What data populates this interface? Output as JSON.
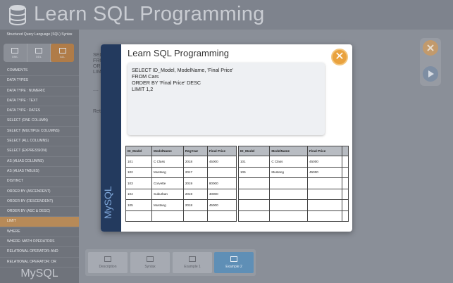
{
  "app": {
    "title": "Learn SQL Programming",
    "sidebar_subtitle": "Structured Query Language (SQL) Syntax",
    "brand": "MySQL"
  },
  "segments": [
    {
      "label": "DML",
      "active": false
    },
    {
      "label": "DDL",
      "active": false
    },
    {
      "label": "ALL",
      "active": true
    }
  ],
  "menu": [
    "COMMENTS",
    "DATA TYPES",
    "DATA TYPE : NUMERIC",
    "DATA TYPE : TEXT",
    "DATA TYPE : DATES",
    "SELECT (ONE COLUMN)",
    "SELECT (MULTIPLE COLUMNS)",
    "SELECT (ALL COLUMNS)",
    "SELECT (EXPRESSION)",
    "AS (ALIAS COLUMNS)",
    "AS (ALIAS TABLES)",
    "DISTINCT",
    "ORDER BY (ASCENDENT)",
    "ORDER BY (DESCENDENT)",
    "ORDER BY (ASC & DESC)",
    "LIMIT",
    "WHERE",
    "WHERE: MATH OPERATORS",
    "RELATIONAL OPERATOR: AND",
    "RELATIONAL OPERATOR: OR"
  ],
  "selected_menu_index": 15,
  "background_fragments": {
    "left_a": "SEL",
    "left_b": "FRO",
    "left_c": "ORD",
    "left_d": "LIM",
    "dots": "....",
    "ret": "Ret"
  },
  "bottom_tabs": [
    {
      "label": "Description",
      "active": false
    },
    {
      "label": "Syntax",
      "active": false
    },
    {
      "label": "Example 1",
      "active": false
    },
    {
      "label": "Example 2",
      "active": true
    }
  ],
  "dialog": {
    "title": "Learn SQL Programming",
    "close_symbol": "✕",
    "side_brand": "MySQL",
    "code_lines": [
      "SELECT ID_Model, ModelName, 'Final Price'",
      "FROM Cars",
      "ORDER BY 'Final Price' DESC",
      "LIMIT 1,2"
    ]
  },
  "table_source": {
    "headers": [
      "ID_Model",
      "ModelName",
      "RegYear",
      "Final Price"
    ],
    "rows": [
      [
        "101",
        "C Class",
        "2018",
        "45000"
      ],
      [
        "102",
        "Mustang",
        "2017",
        ""
      ],
      [
        "103",
        "Corvette",
        "2019",
        "80000"
      ],
      [
        "104",
        "Suburban",
        "2019",
        "40000"
      ],
      [
        "105",
        "Mustang",
        "2018",
        "45000"
      ],
      [
        "",
        "",
        "",
        ""
      ]
    ]
  },
  "table_result": {
    "headers": [
      "ID_Model",
      "ModelName",
      "Final Price",
      ""
    ],
    "rows": [
      [
        "101",
        "C Class",
        "45000",
        ""
      ],
      [
        "105",
        "Mustang",
        "45000",
        ""
      ],
      [
        "",
        "",
        "",
        ""
      ],
      [
        "",
        "",
        "",
        ""
      ],
      [
        "",
        "",
        "",
        ""
      ],
      [
        "",
        "",
        "",
        ""
      ]
    ]
  },
  "colors": {
    "accent_orange": "#e9a23e",
    "selected_menu": "#b78a58",
    "dialog_side": "#233a5e",
    "active_tab": "#5f8fb6"
  }
}
